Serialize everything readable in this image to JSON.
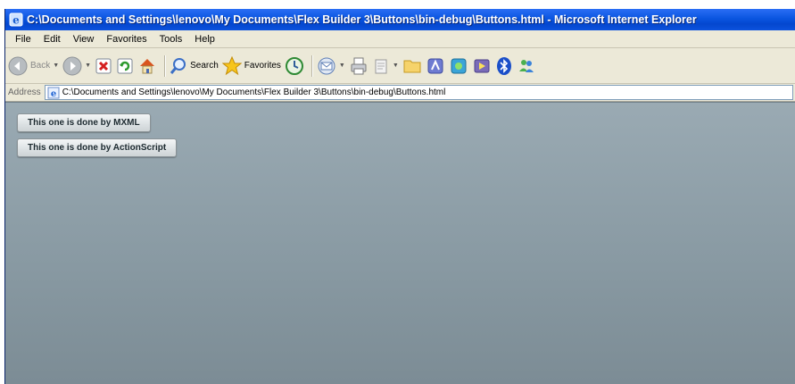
{
  "window": {
    "title": "C:\\Documents and Settings\\lenovo\\My Documents\\Flex Builder 3\\Buttons\\bin-debug\\Buttons.html - Microsoft Internet Explorer"
  },
  "menu": [
    "File",
    "Edit",
    "View",
    "Favorites",
    "Tools",
    "Help"
  ],
  "toolbar": {
    "back_label": "Back",
    "search_label": "Search",
    "favorites_label": "Favorites"
  },
  "address": {
    "label": "Address",
    "url": "C:\\Documents and Settings\\lenovo\\My Documents\\Flex Builder 3\\Buttons\\bin-debug\\Buttons.html"
  },
  "content": {
    "button_mxml": "This one is done by MXML",
    "button_actionscript": "This one is done by ActionScript"
  },
  "colors": {
    "titlebar": "#0a55e0",
    "content_bg": "#899aa3"
  }
}
